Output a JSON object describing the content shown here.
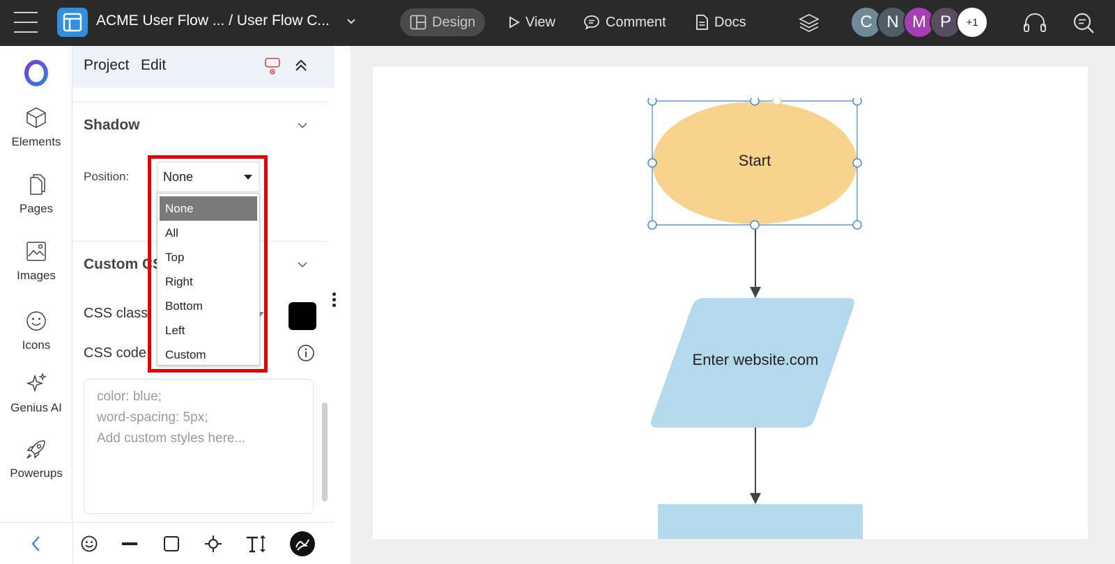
{
  "header": {
    "doc_title": "ACME User Flow ... / User Flow C...",
    "modes": [
      {
        "label": "Design",
        "icon": "layout-icon"
      },
      {
        "label": "View",
        "icon": "play-icon"
      },
      {
        "label": "Comment",
        "icon": "comment-icon"
      },
      {
        "label": "Docs",
        "icon": "document-icon"
      }
    ],
    "avatars": [
      {
        "initial": "C",
        "color": "#6f8a96"
      },
      {
        "initial": "N",
        "color": "#4e5d66"
      },
      {
        "initial": "M",
        "color": "#a63fb3"
      },
      {
        "initial": "P",
        "color": "#5a4d5f"
      }
    ],
    "avatar_more": "+1"
  },
  "rail": {
    "items": [
      {
        "label": "Elements",
        "icon": "cube-icon"
      },
      {
        "label": "Pages",
        "icon": "pages-icon"
      },
      {
        "label": "Images",
        "icon": "image-icon"
      },
      {
        "label": "Icons",
        "icon": "smiley-icon"
      },
      {
        "label": "Genius AI",
        "icon": "sparkle-icon"
      },
      {
        "label": "Powerups",
        "icon": "rocket-icon"
      }
    ]
  },
  "panel": {
    "menu": [
      "Project",
      "Edit"
    ],
    "shadow": {
      "title": "Shadow",
      "position_label": "Position:",
      "position_value": "None",
      "options": [
        "None",
        "All",
        "Top",
        "Right",
        "Bottom",
        "Left",
        "Custom"
      ],
      "selected": "None"
    },
    "custom_css": {
      "title": "Custom CS",
      "class_label": "CSS class:",
      "code_label": "CSS code:",
      "placeholder_lines": [
        "color: blue;",
        "word-spacing: 5px;",
        "Add custom styles here..."
      ],
      "swatch_color": "#000000"
    }
  },
  "canvas": {
    "shapes": [
      {
        "kind": "ellipse",
        "label": "Start",
        "fill": "#f8d38e"
      },
      {
        "kind": "parallelogram",
        "label": "Enter website.com",
        "fill": "#b5d9ec"
      },
      {
        "kind": "rectangle",
        "label": "",
        "fill": "#b5d9ec"
      }
    ]
  },
  "colors": {
    "topbar": "#2a2a2a",
    "accent": "#2f8fe0",
    "highlight": "#e00000"
  }
}
